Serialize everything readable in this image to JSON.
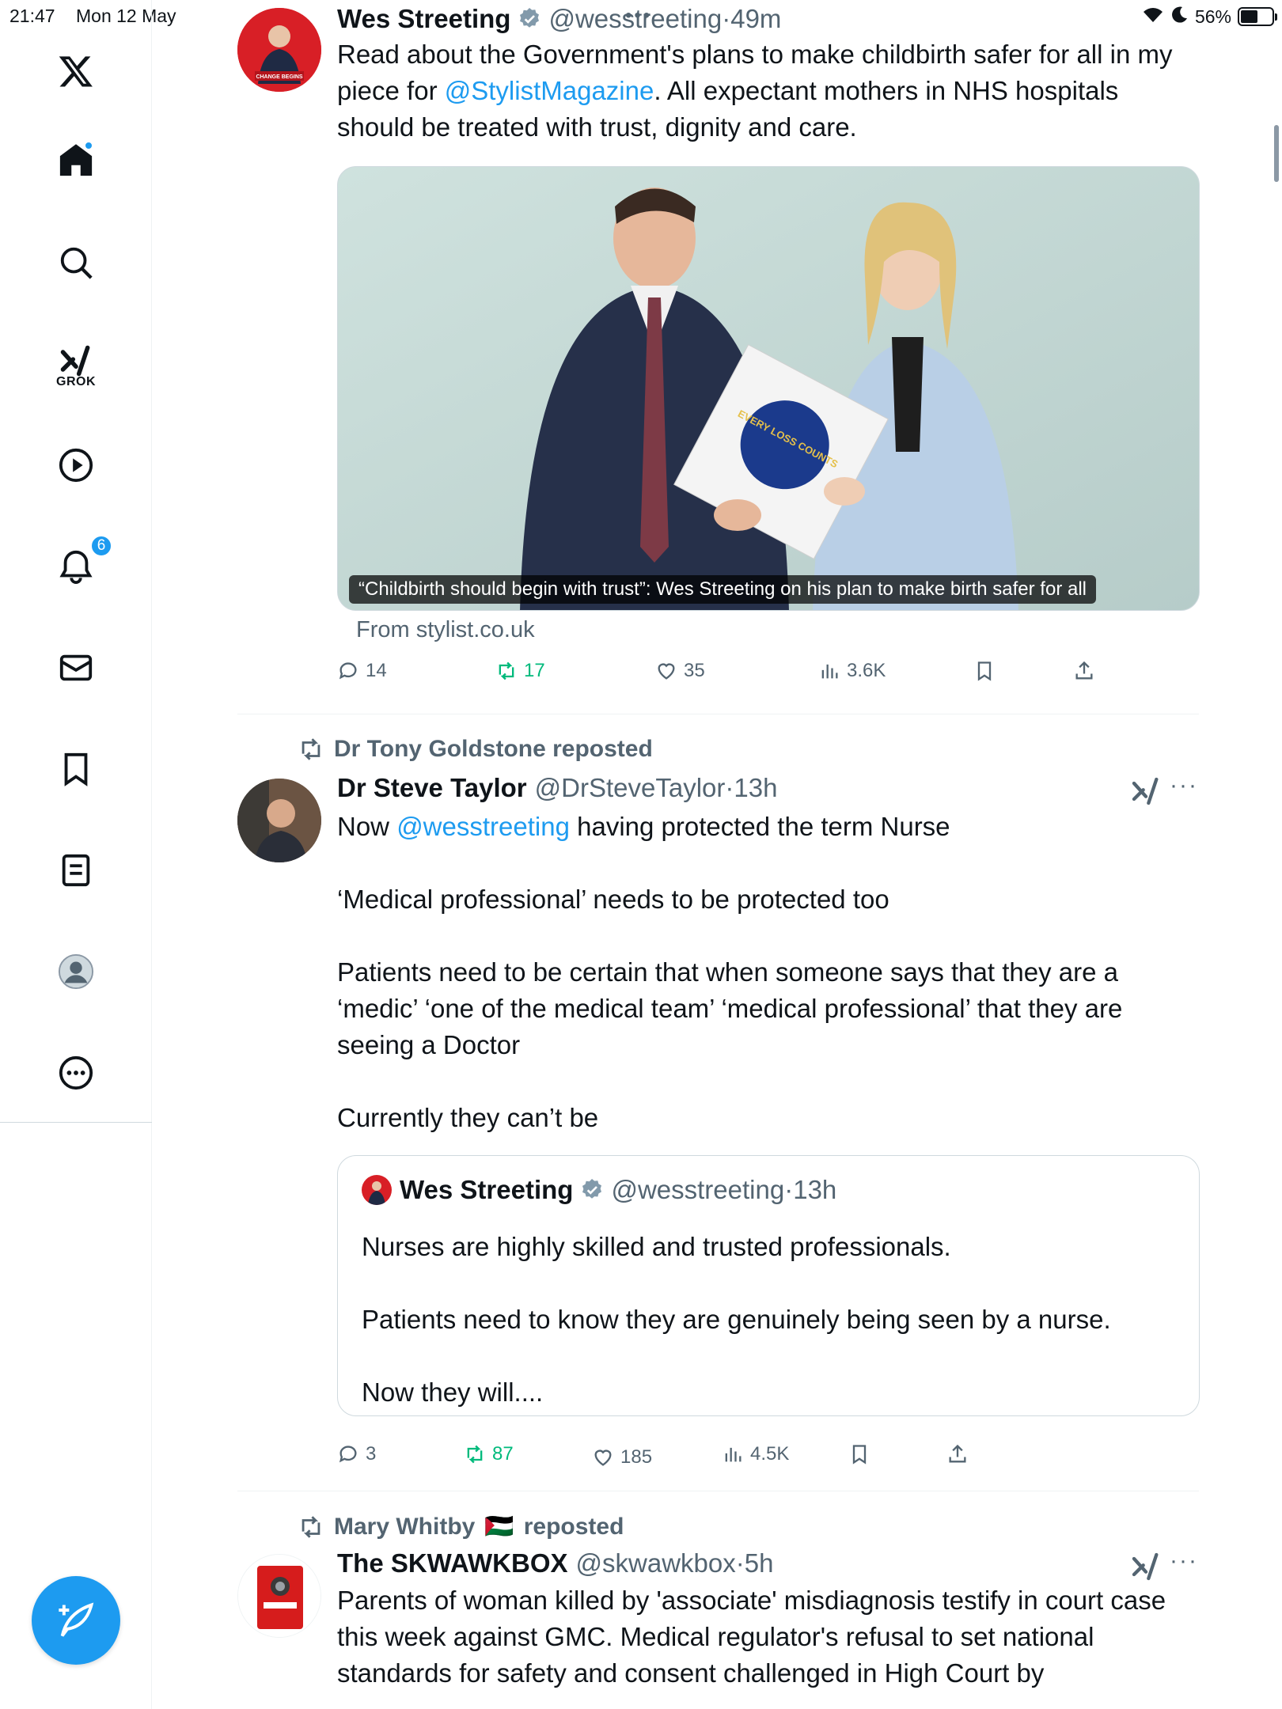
{
  "status_bar": {
    "time": "21:47",
    "date": "Mon 12 May",
    "battery": "56%",
    "battery_level": 0.56
  },
  "sidebar": {
    "items": [
      {
        "name": "x-logo",
        "label": ""
      },
      {
        "name": "home",
        "label": ""
      },
      {
        "name": "search",
        "label": ""
      },
      {
        "name": "grok",
        "label": "GROK"
      },
      {
        "name": "video",
        "label": ""
      },
      {
        "name": "notifications",
        "label": "",
        "badge": "6"
      },
      {
        "name": "messages",
        "label": ""
      },
      {
        "name": "bookmarks",
        "label": ""
      },
      {
        "name": "lists",
        "label": ""
      },
      {
        "name": "profile",
        "label": ""
      },
      {
        "name": "more",
        "label": ""
      }
    ]
  },
  "tweets": [
    {
      "display_name": "Wes Streeting",
      "handle": "@wesstreeting",
      "dot": "·",
      "time": "49m",
      "text_before": "Read about the Government's plans to make childbirth safer for all in my piece for ",
      "mention": "@StylistMagazine",
      "text_after": ". All expectant mothers in NHS hospitals should be treated with trust, dignity and care.",
      "media_caption": "“Childbirth should begin with trust”: Wes Streeting on his plan to make birth safer for all",
      "book_title": "EVERY LOSS COUNTS",
      "from": "From stylist.co.uk",
      "replies": "14",
      "reposts": "17",
      "likes": "35",
      "views": "3.6K",
      "avatar_text": "CHANGE BEGINS"
    },
    {
      "repost_by": "Dr Tony Goldstone reposted",
      "display_name": "Dr Steve Taylor",
      "handle": "@DrSteveTaylor",
      "dot": "·",
      "time": "13h",
      "text_before": "Now ",
      "mention": "@wesstreeting",
      "text_after": " having protected the term Nurse\n\n‘Medical professional’ needs to be protected too\n\nPatients need to be certain that when someone says that they are a ‘medic’ ‘one of the medical team’ ‘medical professional’ that they are seeing a Doctor\n\nCurrently they can’t be",
      "quote": {
        "display_name": "Wes Streeting",
        "handle": "@wesstreeting",
        "dot": "·",
        "time": "13h",
        "text": "Nurses are highly skilled and trusted professionals.\n\nPatients need to know they are genuinely being seen by a nurse.\n\nNow they will...."
      },
      "replies": "3",
      "reposts": "87",
      "likes": "185",
      "views": "4.5K"
    },
    {
      "repost_by": "Mary Whitby",
      "repost_flag": "🇵🇸",
      "repost_suffix": "reposted",
      "display_name": "The SKWAWKBOX",
      "handle": "@skwawkbox",
      "dot": "·",
      "time": "5h",
      "text": "Parents of woman killed by 'associate' misdiagnosis testify in court case this week against GMC. Medical regulator's refusal to set national standards for safety and consent challenged in High Court by"
    }
  ],
  "colors": {
    "accent": "#1d9bf0",
    "repost_green": "#00ba7c",
    "muted": "#536471",
    "text": "#0f1419"
  }
}
